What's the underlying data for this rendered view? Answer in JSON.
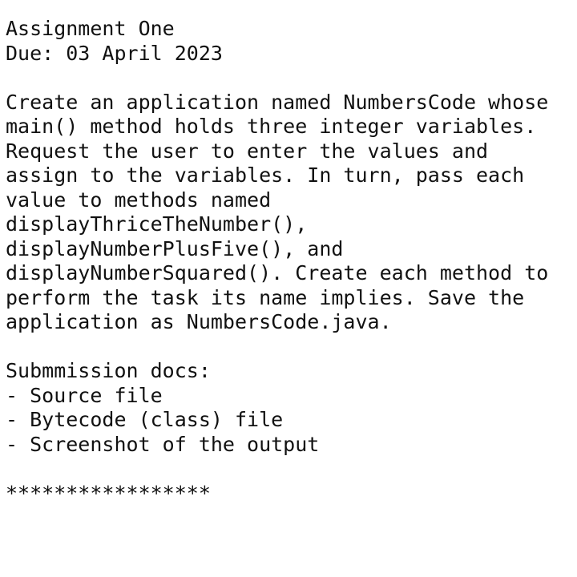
{
  "header": {
    "title": "Assignment One",
    "due": "Due: 03 April 2023"
  },
  "body": {
    "lines": [
      "Create an application named NumbersCode whose",
      "main() method holds three integer variables.",
      "Request the user to enter the values and",
      "assign to the variables. In turn, pass each",
      "value to methods named",
      "displayThriceTheNumber(),",
      "displayNumberPlusFive(), and",
      "displayNumberSquared(). Create each method to",
      "perform the task its name implies. Save the",
      "application as NumbersCode.java."
    ]
  },
  "submission": {
    "heading": "Submmission docs:",
    "items": [
      "- Source file",
      "- Bytecode (class) file",
      "- Screenshot of the output"
    ]
  },
  "divider": "*****************"
}
